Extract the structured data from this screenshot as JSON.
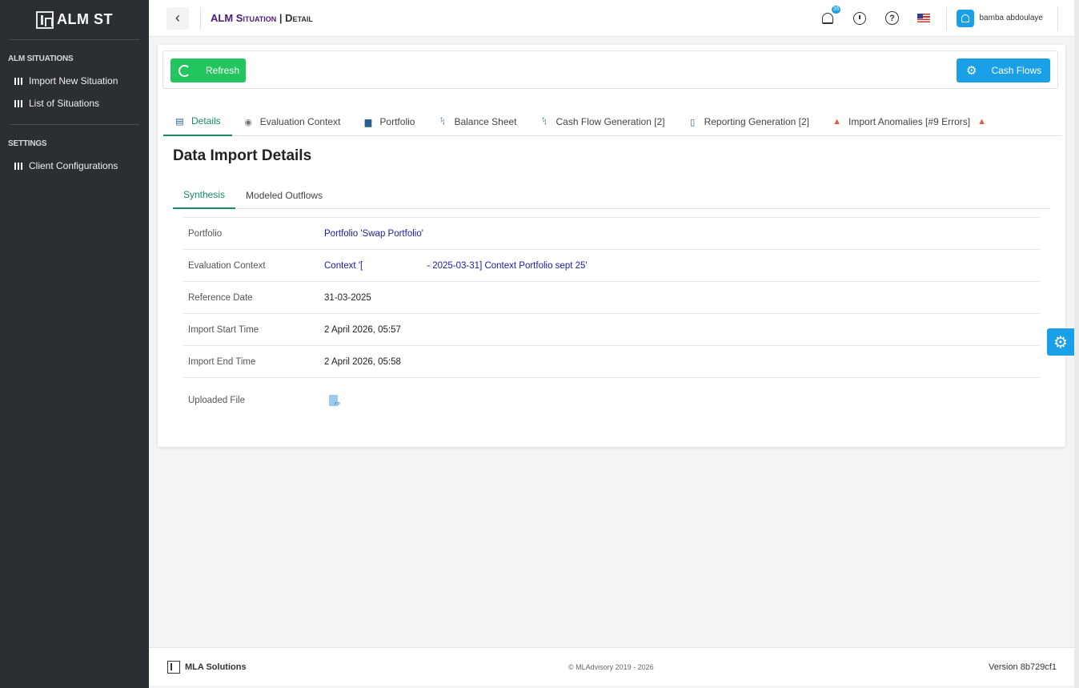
{
  "sidebar": {
    "brand": "ALM ST",
    "sections": [
      {
        "title": "ALM SITUATIONS",
        "items": [
          "Import New Situation",
          "List of Situations"
        ]
      },
      {
        "title": "SETTINGS",
        "items": [
          "Client Configurations"
        ]
      }
    ]
  },
  "topbar": {
    "back_glyph": "‹",
    "title_prefix": "ALM",
    "title_word": "Situation",
    "title_sep": " | ",
    "title_detail": "Detail",
    "notification_count": "35",
    "help_glyph": "?",
    "user_name": "bamba abdoulaye"
  },
  "actions": {
    "refresh_label": "Refresh",
    "cash_flows_label": "Cash Flows"
  },
  "tabs": [
    {
      "label": "Details",
      "icon": "id-card-icon",
      "glyph": "▤"
    },
    {
      "label": "Evaluation Context",
      "icon": "globe-icon",
      "glyph": "◉"
    },
    {
      "label": "Portfolio",
      "icon": "briefcase-icon",
      "glyph": "▆"
    },
    {
      "label": "Balance Sheet",
      "icon": "chart-icon",
      "glyph": "ᛪ"
    },
    {
      "label": "Cash Flow Generation [2]",
      "icon": "chart-icon",
      "glyph": "ᛪ"
    },
    {
      "label": "Reporting Generation [2]",
      "icon": "file-icon",
      "glyph": "▯"
    },
    {
      "label": "Import Anomalies [#9 Errors]",
      "icon": "warning-icon",
      "glyph": "▲"
    }
  ],
  "section_title": "Data Import Details",
  "subtabs": [
    "Synthesis",
    "Modeled Outflows"
  ],
  "details": {
    "portfolio_label": "Portfolio",
    "portfolio_value": "Portfolio 'Swap Portfolio'",
    "eval_label": "Evaluation Context",
    "eval_value_a": "Context '[",
    "eval_value_b": "- 2025-03-31] Context Portfolio sept 25'",
    "ref_date_label": "Reference Date",
    "ref_date_value": "31-03-2025",
    "start_label": "Import Start Time",
    "start_value": "2 April 2026, 05:57",
    "end_label": "Import End Time",
    "end_value": "2 April 2026, 05:58",
    "file_label": "Uploaded File"
  },
  "footer": {
    "brand": "MLA Solutions",
    "copyright": "© MLAdvisory 2019 - 2026",
    "version": "Version 8b729cf1"
  },
  "colors": {
    "sidebar_bg": "#2b2e33",
    "accent_green": "#22c55e",
    "tab_active": "#148a66",
    "accent_blue": "#1aa0e6",
    "title_purple": "#4b1a7a",
    "link_blue": "#1a1aa6"
  }
}
